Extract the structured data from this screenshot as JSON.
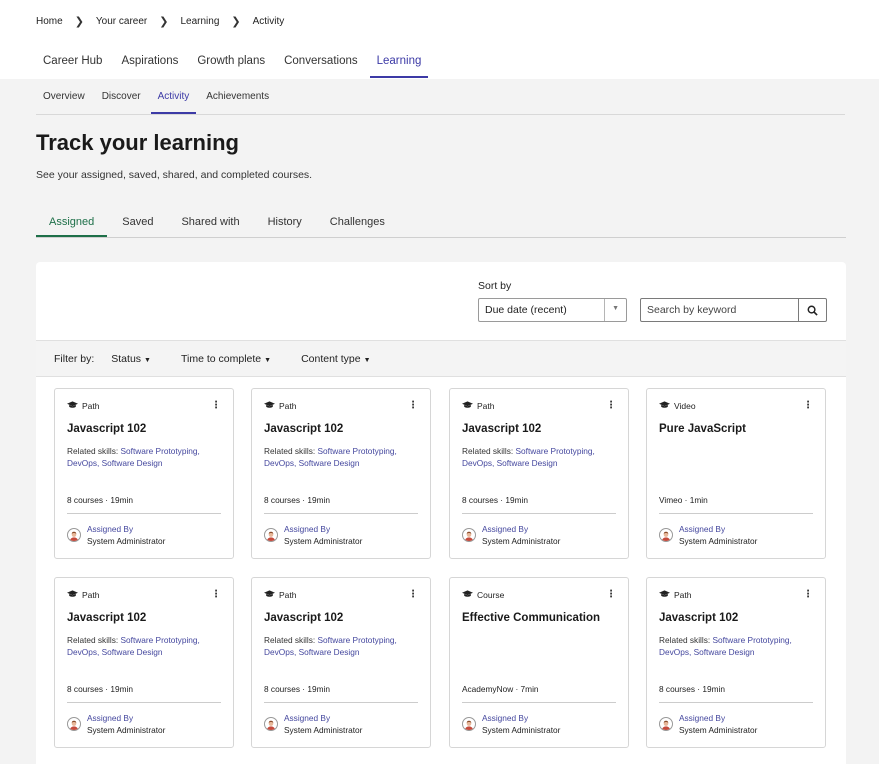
{
  "breadcrumb": [
    "Home",
    "Your career",
    "Learning",
    "Activity"
  ],
  "main_tabs": [
    "Career Hub",
    "Aspirations",
    "Growth plans",
    "Conversations",
    "Learning"
  ],
  "sub_tabs": [
    "Overview",
    "Discover",
    "Activity",
    "Achievements"
  ],
  "page": {
    "title": "Track your learning",
    "subtitle": "See your assigned, saved, shared, and completed courses."
  },
  "learning_tabs": [
    "Assigned",
    "Saved",
    "Shared with",
    "History",
    "Challenges"
  ],
  "sort": {
    "label": "Sort by",
    "value": "Due date (recent)"
  },
  "search": {
    "placeholder": "Search by keyword"
  },
  "filters": {
    "label": "Filter by:",
    "items": [
      "Status",
      "Time to complete",
      "Content type"
    ]
  },
  "cards": [
    {
      "type": "Path",
      "title": "Javascript 102",
      "skills_label": "Related skills: ",
      "skills": "Software Prototyping, DevOps, Software Design",
      "meta": "8 courses · 19min",
      "assigned_label": "Assigned By",
      "assigned_by": "System Administrator"
    },
    {
      "type": "Path",
      "title": "Javascript 102",
      "skills_label": "Related skills: ",
      "skills": "Software Prototyping, DevOps, Software Design",
      "meta": "8 courses · 19min",
      "assigned_label": "Assigned By",
      "assigned_by": "System Administrator"
    },
    {
      "type": "Path",
      "title": "Javascript 102",
      "skills_label": "Related skills: ",
      "skills": "Software Prototyping, DevOps, Software Design",
      "meta": "8 courses · 19min",
      "assigned_label": "Assigned By",
      "assigned_by": "System Administrator"
    },
    {
      "type": "Video",
      "title": "Pure JavaScript",
      "skills_label": "",
      "skills": "",
      "meta": "Vimeo · 1min",
      "assigned_label": "Assigned By",
      "assigned_by": "System Administrator"
    },
    {
      "type": "Path",
      "title": "Javascript 102",
      "skills_label": "Related skills: ",
      "skills": "Software Prototyping, DevOps, Software Design",
      "meta": "8 courses · 19min",
      "assigned_label": "Assigned By",
      "assigned_by": "System Administrator"
    },
    {
      "type": "Path",
      "title": "Javascript 102",
      "skills_label": "Related skills: ",
      "skills": "Software Prototyping, DevOps, Software Design",
      "meta": "8 courses · 19min",
      "assigned_label": "Assigned By",
      "assigned_by": "System Administrator"
    },
    {
      "type": "Course",
      "title": "Effective Communication",
      "skills_label": "",
      "skills": "",
      "meta": "AcademyNow · 7min",
      "assigned_label": "Assigned By",
      "assigned_by": "System Administrator"
    },
    {
      "type": "Path",
      "title": "Javascript 102",
      "skills_label": "Related skills: ",
      "skills": "Software Prototyping, DevOps, Software Design",
      "meta": "8 courses · 19min",
      "assigned_label": "Assigned By",
      "assigned_by": "System Administrator"
    }
  ]
}
